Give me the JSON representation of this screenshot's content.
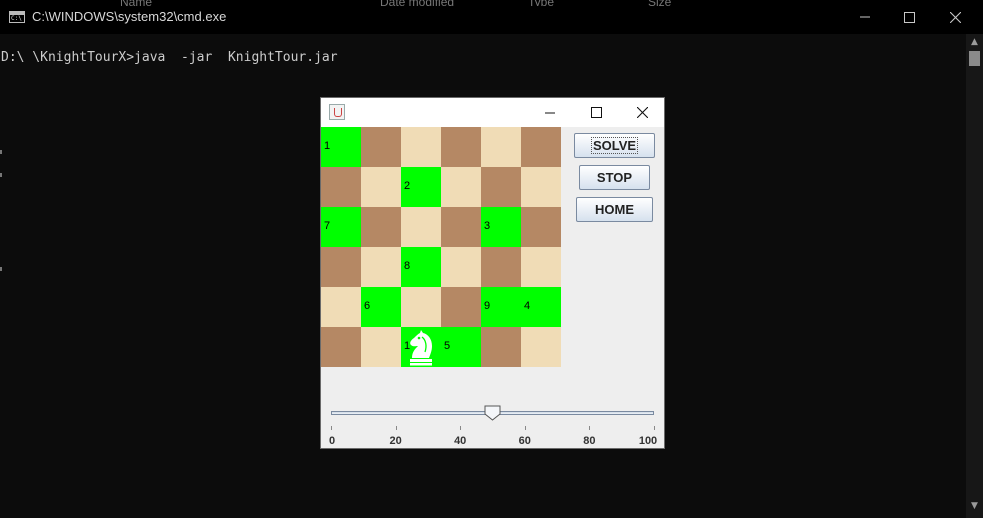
{
  "console_window": {
    "title": "C:\\WINDOWS\\system32\\cmd.exe",
    "icon": "cmd-icon",
    "icon_text": "C:\\",
    "controls": [
      "minimize-icon",
      "maximize-icon",
      "close-icon"
    ],
    "background_header_labels": [
      "Name",
      "Date modified",
      "Type",
      "Size"
    ],
    "prompt_line": "D:\\ \\KnightTourX>java  -jar  KnightTour.jar"
  },
  "java_window": {
    "title": "",
    "icon": "java-coffee-icon",
    "controls": [
      "minimize-icon",
      "maximize-icon",
      "close-icon"
    ],
    "buttons": {
      "solve": "SOLVE",
      "stop": "STOP",
      "home": "HOME"
    },
    "board": {
      "size": 6,
      "visited": [
        {
          "row": 0,
          "col": 0,
          "label": "1"
        },
        {
          "row": 1,
          "col": 2,
          "label": "2"
        },
        {
          "row": 2,
          "col": 4,
          "label": "3"
        },
        {
          "row": 4,
          "col": 5,
          "label": "4"
        },
        {
          "row": 5,
          "col": 3,
          "label": "5"
        },
        {
          "row": 4,
          "col": 1,
          "label": "6"
        },
        {
          "row": 2,
          "col": 0,
          "label": "7"
        },
        {
          "row": 3,
          "col": 2,
          "label": "8"
        },
        {
          "row": 4,
          "col": 4,
          "label": "9"
        },
        {
          "row": 5,
          "col": 2,
          "label": "1"
        }
      ],
      "knight_position": {
        "row": 5,
        "col": 2
      },
      "colors": {
        "light": "#f0dcb6",
        "dark": "#b58864",
        "visited": "#00ff00"
      }
    },
    "slider": {
      "min": 0,
      "max": 100,
      "value": 50,
      "tick_labels": [
        "0",
        "20",
        "40",
        "60",
        "80",
        "100"
      ]
    }
  }
}
